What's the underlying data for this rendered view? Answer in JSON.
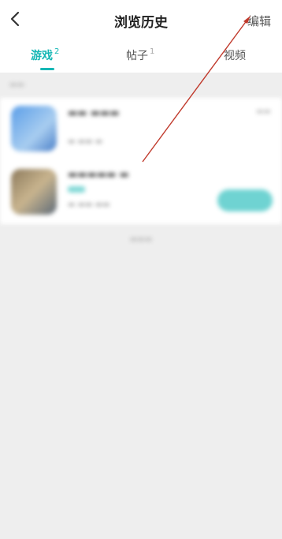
{
  "header": {
    "title": "浏览历史",
    "edit_label": "编辑"
  },
  "tabs": [
    {
      "label": "游戏",
      "count": "2",
      "active": true
    },
    {
      "label": "帖子",
      "count": "1",
      "active": false
    },
    {
      "label": "视频",
      "count": "",
      "active": false
    }
  ],
  "colors": {
    "accent": "#15b7b5",
    "annotation_arrow": "#c0392b"
  }
}
